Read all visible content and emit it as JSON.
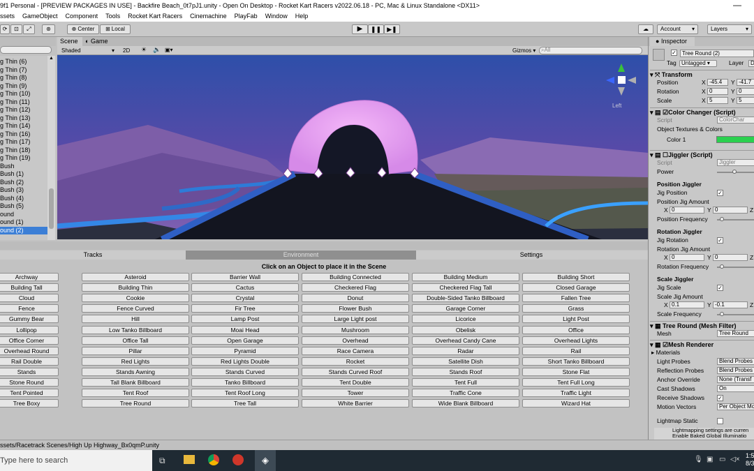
{
  "window": {
    "title": "9f1 Personal - [PREVIEW PACKAGES IN USE] - Backfire Beach_0t7pJ1.unity - Open On Desktop - Rocket Kart Racers v2022.06.18 - PC, Mac & Linux Standalone <DX11>",
    "minimize": "—"
  },
  "menu": [
    "ssets",
    "GameObject",
    "Component",
    "Tools",
    "Rocket Kart Racers",
    "Cinemachine",
    "PlayFab",
    "Window",
    "Help"
  ],
  "toolbar": {
    "center": "Center",
    "local": "Local",
    "account": "Account",
    "layers": "Layers"
  },
  "hierarchy": {
    "search": "",
    "items": [
      "g Thin (6)",
      "g Thin (7)",
      "g Thin (8)",
      "g Thin (9)",
      "g Thin (10)",
      "g Thin (11)",
      "g Thin (12)",
      "g Thin (13)",
      "g Thin (14)",
      "g Thin (16)",
      "g Thin (17)",
      "g Thin (18)",
      "g Thin (19)",
      "Bush",
      "Bush (1)",
      "Bush (2)",
      "Bush (3)",
      "Bush (4)",
      "Bush (5)",
      "ound",
      "ound (1)",
      "ound (2)"
    ],
    "selected_index": 21
  },
  "scene": {
    "tab_scene": "Scene",
    "tab_game": "Game",
    "shading": "Shaded",
    "mode": "2D",
    "gizmos": "Gizmos",
    "search_placeholder": "All",
    "persp": "Left"
  },
  "env": {
    "tabs": [
      "Tracks",
      "Environment",
      "Settings"
    ],
    "active_tab": 1,
    "instruction": "Click on an Object to place it in the Scene",
    "objects": [
      "Archway",
      "Asteroid",
      "Barrier Wall",
      "Building Connected",
      "Building Medium",
      "Building Short",
      "Building Tall",
      "Building Thin",
      "Cactus",
      "Checkered Flag",
      "Checkered Flag Tall",
      "Closed Garage",
      "Cloud",
      "Cookie",
      "Crystal",
      "Donut",
      "Double-Sided Tanko Billboard",
      "Fallen Tree",
      "Fence",
      "Fence Curved",
      "Fir Tree",
      "Flower Bush",
      "Garage Corner",
      "Grass",
      "Gummy Bear",
      "Hill",
      "Lamp Post",
      "Large Light post",
      "Licorice",
      "Light Post",
      "Lollipop",
      "Low Tanko Billboard",
      "Moai Head",
      "Mushroom",
      "Obelisk",
      "Office",
      "Office Corner",
      "Office Tall",
      "Open Garage",
      "Overhead",
      "Overhead Candy Cane",
      "Overhead Lights",
      "Overhead Round",
      "Pillar",
      "Pyramid",
      "Race Camera",
      "Radar",
      "Rail",
      "Rail Double",
      "Red Lights",
      "Red Lights Double",
      "Rocket",
      "Satellite Dish",
      "Short Tanko Billboard",
      "Stands",
      "Stands Awning",
      "Stands Curved",
      "Stands Curved Roof",
      "Stands Roof",
      "Stone Flat",
      "Stone Round",
      "Tall Blank Billboard",
      "Tanko Billboard",
      "Tent Double",
      "Tent Full",
      "Tent Full Long",
      "Tent Pointed",
      "Tent Roof",
      "Tent Roof Long",
      "Tower",
      "Traffic Cone",
      "Traffic Light",
      "Tree Boxy",
      "Tree Round",
      "Tree Tall",
      "White Barrier",
      "Wide Blank Billboard",
      "Wizard Hat"
    ]
  },
  "status": {
    "path": "ssets/Racetrack Scenes/High Up Highway_Bx0qmP.unity"
  },
  "taskbar": {
    "search": "Type here to search",
    "time": "1:5",
    "date": "8/3"
  },
  "inspector": {
    "tab": "Inspector",
    "name": "Tree Round (2)",
    "tag_label": "Tag",
    "tag": "Untagged",
    "layer_label": "Layer",
    "layer": "D",
    "transform": {
      "title": "Transform",
      "position": "Position",
      "rotation": "Rotation",
      "scale": "Scale",
      "px": "-45.4",
      "py": "-41.7",
      "rx": "0",
      "ry": "0",
      "sx": "5",
      "sy": "5"
    },
    "color_changer": {
      "title": "Color Changer (Script)",
      "script_label": "Script",
      "script": "ColorChar",
      "textures": "Object Textures & Colors",
      "color1": "Color 1",
      "color_hex": "#2bd04f"
    },
    "jiggler": {
      "title": "Jiggler (Script)",
      "script_label": "Script",
      "script": "Jiggler",
      "power": "Power",
      "pos_title": "Position Jiggler",
      "jig_pos": "Jig Position",
      "pos_amount": "Position Jig Amount",
      "pos_freq": "Position Frequency",
      "rot_title": "Rotation Jiggler",
      "jig_rot": "Jig Rotation",
      "rot_amount": "Rotation Jig Amount",
      "rot_freq": "Rotation Frequency",
      "scale_title": "Scale Jiggler",
      "jig_scale": "Jig Scale",
      "scale_amount": "Scale Jig Amount",
      "scale_freq": "Scale Frequency",
      "px": "0",
      "py": "0",
      "rx": "0",
      "ry": "0",
      "sx": "0.1",
      "sy": "-0.1"
    },
    "mesh_filter": {
      "title": "Tree Round (Mesh Filter)",
      "mesh_label": "Mesh",
      "mesh": "Tree Round"
    },
    "mesh_renderer": {
      "title": "Mesh Renderer",
      "materials": "Materials",
      "light_probes": "Light Probes",
      "light_probes_val": "Blend Probes",
      "refl_probes": "Reflection Probes",
      "refl_probes_val": "Blend Probes",
      "anchor": "Anchor Override",
      "anchor_val": "None (Transf",
      "cast": "Cast Shadows",
      "cast_val": "On",
      "receive": "Receive Shadows",
      "motion": "Motion Vectors",
      "motion_val": "Per Object Mo",
      "lightmap_static": "Lightmap Static",
      "lightmap_note1": "Lightmapping settings are curren",
      "lightmap_note2": "Enable Baked Global Illuminatio"
    }
  }
}
